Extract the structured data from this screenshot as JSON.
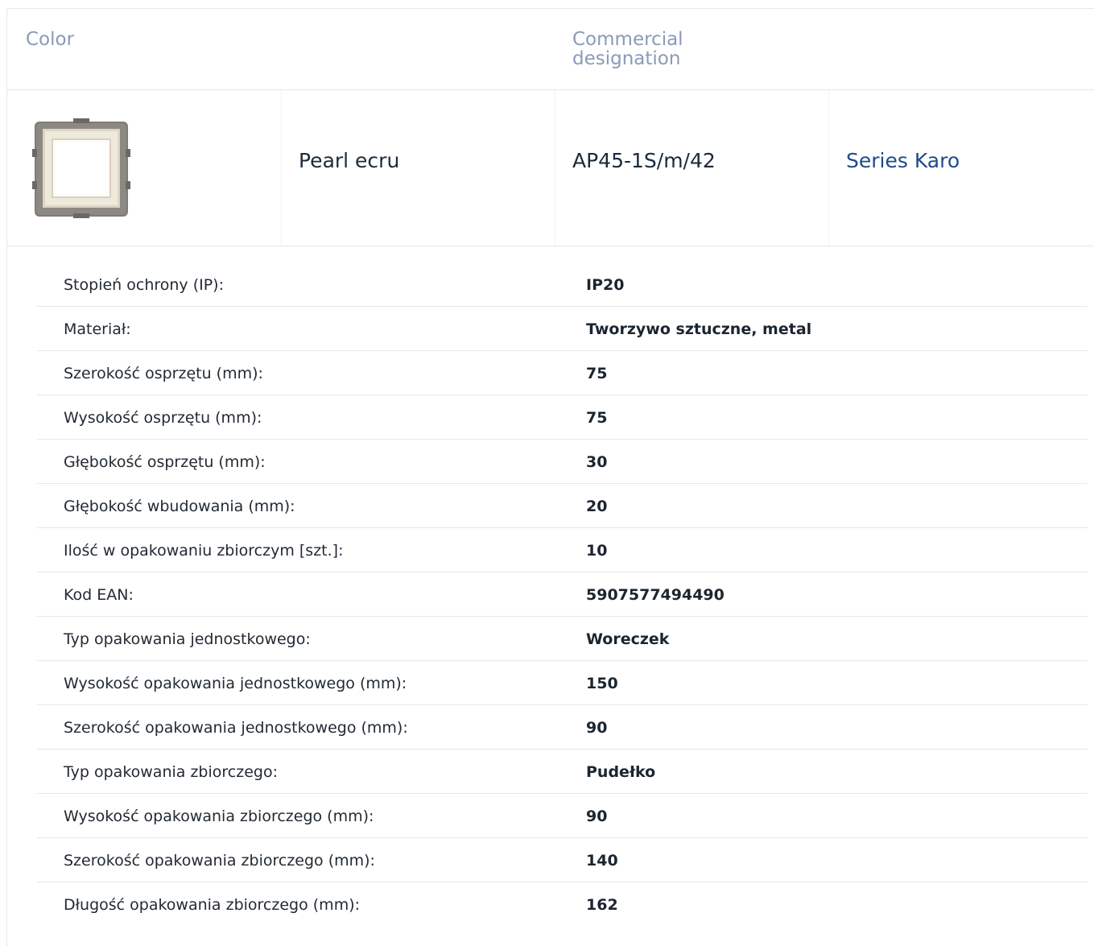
{
  "header": {
    "color_label": "Color",
    "designation_label": "Commercial designation"
  },
  "product": {
    "image_icon": "socket-switch-frame-thumbnail",
    "color": "Pearl ecru",
    "code": "AP45-1S/m/42",
    "series": "Series Karo"
  },
  "specs": [
    {
      "label": "Stopień ochrony (IP):",
      "value": "IP20"
    },
    {
      "label": "Materiał:",
      "value": "Tworzywo sztuczne, metal"
    },
    {
      "label": "Szerokość osprzętu (mm):",
      "value": "75"
    },
    {
      "label": "Wysokość osprzętu (mm):",
      "value": "75"
    },
    {
      "label": "Głębokość osprzętu (mm):",
      "value": "30"
    },
    {
      "label": "Głębokość wbudowania (mm):",
      "value": "20"
    },
    {
      "label": "Ilość w opakowaniu zbiorczym [szt.]:",
      "value": "10"
    },
    {
      "label": "Kod EAN:",
      "value": "5907577494490"
    },
    {
      "label": "Typ opakowania jednostkowego:",
      "value": "Woreczek"
    },
    {
      "label": "Wysokość opakowania jednostkowego (mm):",
      "value": "150"
    },
    {
      "label": "Szerokość opakowania jednostkowego (mm):",
      "value": "90"
    },
    {
      "label": "Typ opakowania zbiorczego:",
      "value": "Pudełko"
    },
    {
      "label": "Wysokość opakowania zbiorczego (mm):",
      "value": "90"
    },
    {
      "label": "Szerokość opakowania zbiorczego (mm):",
      "value": "140"
    },
    {
      "label": "Długość opakowania zbiorczego (mm):",
      "value": "162"
    }
  ],
  "colors": {
    "header_text": "#8a9ab8",
    "link": "#1f4a8c",
    "border": "#e5e7ea",
    "body_text": "#222a33"
  }
}
